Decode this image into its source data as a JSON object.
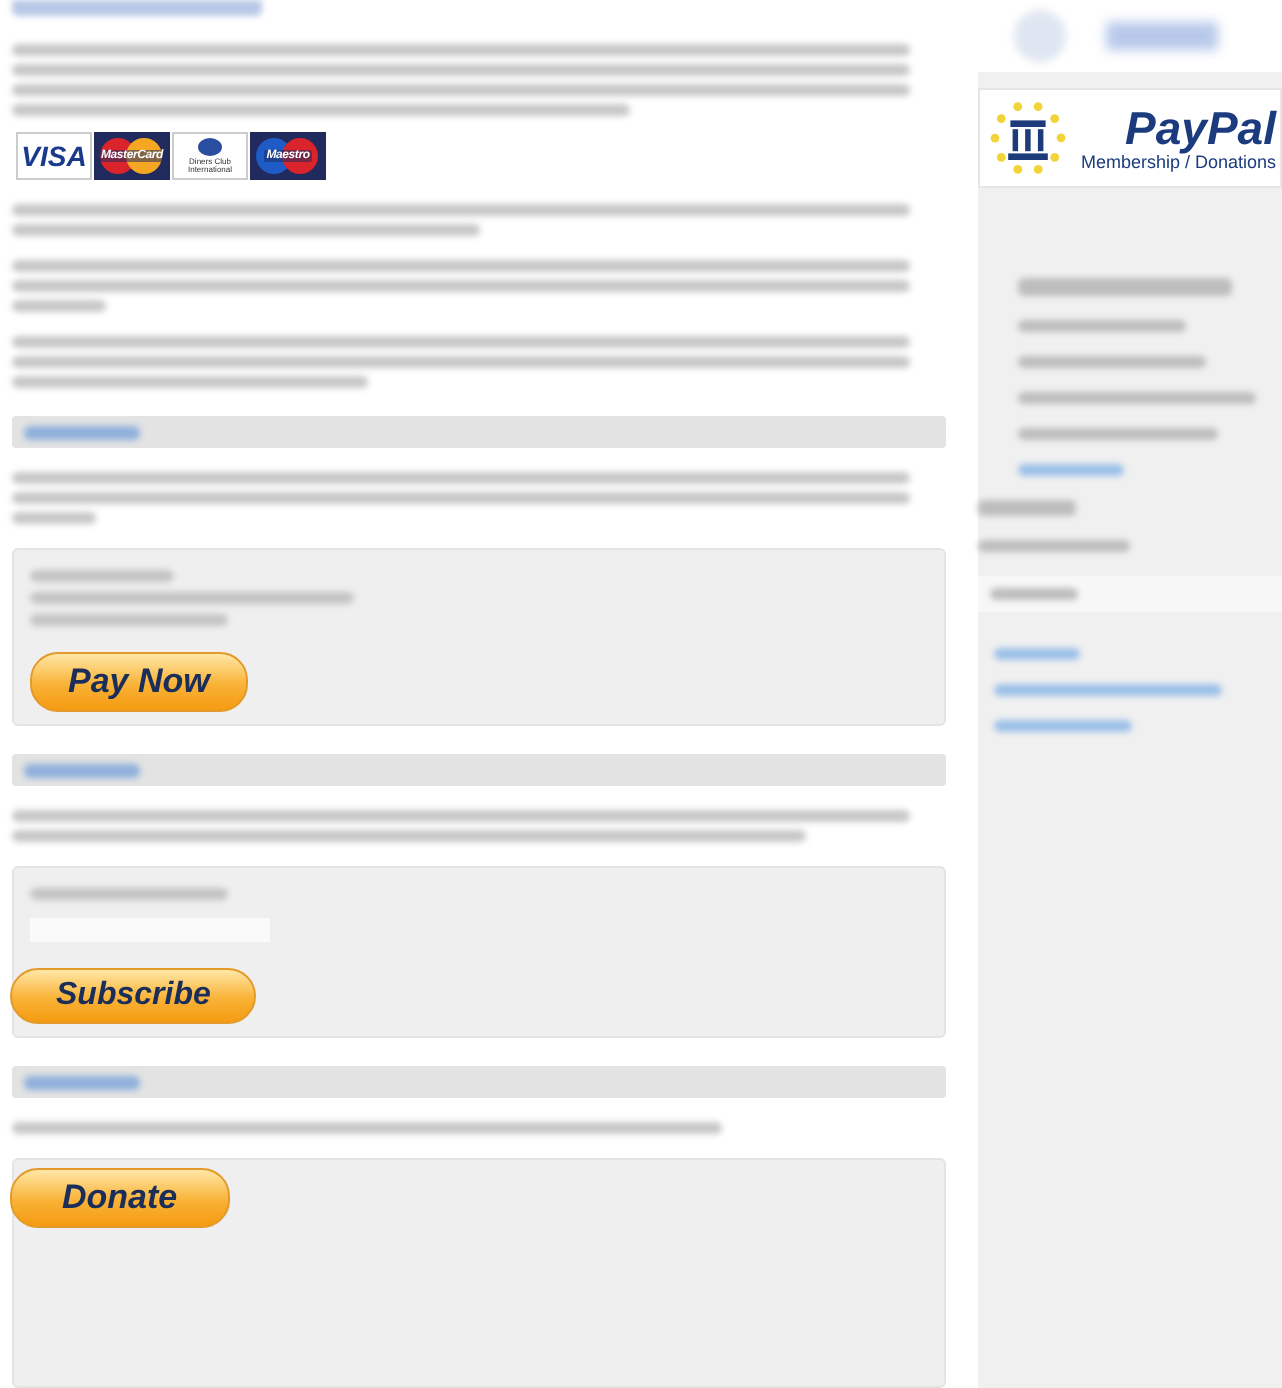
{
  "card_logos": [
    {
      "kind": "visa",
      "label": "VISA"
    },
    {
      "kind": "mastercard",
      "label": "MasterCard"
    },
    {
      "kind": "diners",
      "label": "Diners Club International"
    },
    {
      "kind": "maestro",
      "label": "Maestro"
    }
  ],
  "buttons": [
    {
      "label": "Pay Now"
    },
    {
      "label": "Subscribe"
    },
    {
      "label": "Donate"
    }
  ],
  "sidebar": {
    "badge": {
      "brand": "PayPal",
      "caption": "Membership / Donations"
    }
  }
}
